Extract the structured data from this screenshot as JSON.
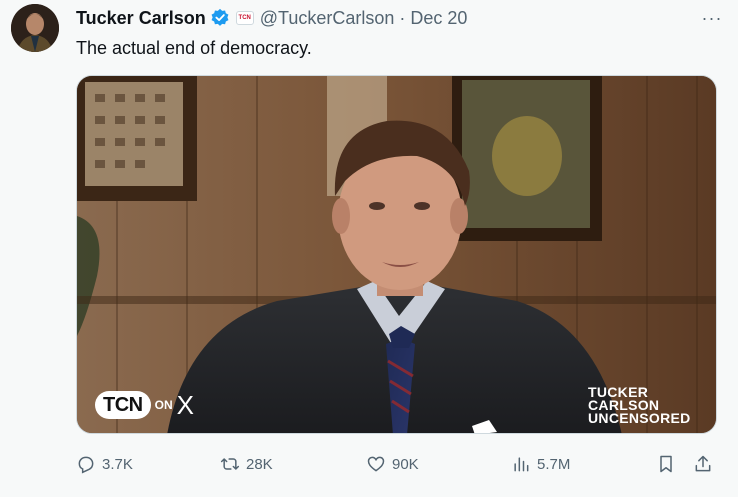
{
  "author": {
    "name": "Tucker Carlson",
    "handle": "@TuckerCarlson",
    "date": "Dec 20",
    "affiliation_badge": "TCN",
    "verified_color": "#1d9bf0"
  },
  "post": {
    "text": "The actual end of democracy."
  },
  "media": {
    "logo_left": {
      "brand": "TCN",
      "on": "ON",
      "x": "X"
    },
    "logo_right": {
      "line1": "TUCKER",
      "line2": "CARLSON",
      "line3": "UNCENSORED"
    }
  },
  "actions": {
    "replies": "3.7K",
    "reposts": "28K",
    "likes": "90K",
    "views": "5.7M",
    "icons": [
      "reply-icon",
      "repost-icon",
      "like-icon",
      "views-icon",
      "bookmark-icon",
      "share-icon"
    ]
  },
  "menu": {
    "more": "···"
  }
}
